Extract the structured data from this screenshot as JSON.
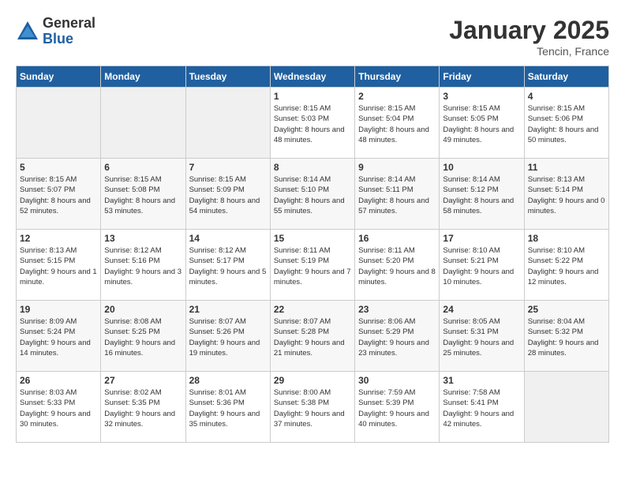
{
  "logo": {
    "general": "General",
    "blue": "Blue"
  },
  "title": "January 2025",
  "location": "Tencin, France",
  "days_of_week": [
    "Sunday",
    "Monday",
    "Tuesday",
    "Wednesday",
    "Thursday",
    "Friday",
    "Saturday"
  ],
  "weeks": [
    [
      {
        "day": "",
        "sunrise": "",
        "sunset": "",
        "daylight": ""
      },
      {
        "day": "",
        "sunrise": "",
        "sunset": "",
        "daylight": ""
      },
      {
        "day": "",
        "sunrise": "",
        "sunset": "",
        "daylight": ""
      },
      {
        "day": "1",
        "sunrise": "Sunrise: 8:15 AM",
        "sunset": "Sunset: 5:03 PM",
        "daylight": "Daylight: 8 hours and 48 minutes."
      },
      {
        "day": "2",
        "sunrise": "Sunrise: 8:15 AM",
        "sunset": "Sunset: 5:04 PM",
        "daylight": "Daylight: 8 hours and 48 minutes."
      },
      {
        "day": "3",
        "sunrise": "Sunrise: 8:15 AM",
        "sunset": "Sunset: 5:05 PM",
        "daylight": "Daylight: 8 hours and 49 minutes."
      },
      {
        "day": "4",
        "sunrise": "Sunrise: 8:15 AM",
        "sunset": "Sunset: 5:06 PM",
        "daylight": "Daylight: 8 hours and 50 minutes."
      }
    ],
    [
      {
        "day": "5",
        "sunrise": "Sunrise: 8:15 AM",
        "sunset": "Sunset: 5:07 PM",
        "daylight": "Daylight: 8 hours and 52 minutes."
      },
      {
        "day": "6",
        "sunrise": "Sunrise: 8:15 AM",
        "sunset": "Sunset: 5:08 PM",
        "daylight": "Daylight: 8 hours and 53 minutes."
      },
      {
        "day": "7",
        "sunrise": "Sunrise: 8:15 AM",
        "sunset": "Sunset: 5:09 PM",
        "daylight": "Daylight: 8 hours and 54 minutes."
      },
      {
        "day": "8",
        "sunrise": "Sunrise: 8:14 AM",
        "sunset": "Sunset: 5:10 PM",
        "daylight": "Daylight: 8 hours and 55 minutes."
      },
      {
        "day": "9",
        "sunrise": "Sunrise: 8:14 AM",
        "sunset": "Sunset: 5:11 PM",
        "daylight": "Daylight: 8 hours and 57 minutes."
      },
      {
        "day": "10",
        "sunrise": "Sunrise: 8:14 AM",
        "sunset": "Sunset: 5:12 PM",
        "daylight": "Daylight: 8 hours and 58 minutes."
      },
      {
        "day": "11",
        "sunrise": "Sunrise: 8:13 AM",
        "sunset": "Sunset: 5:14 PM",
        "daylight": "Daylight: 9 hours and 0 minutes."
      }
    ],
    [
      {
        "day": "12",
        "sunrise": "Sunrise: 8:13 AM",
        "sunset": "Sunset: 5:15 PM",
        "daylight": "Daylight: 9 hours and 1 minute."
      },
      {
        "day": "13",
        "sunrise": "Sunrise: 8:12 AM",
        "sunset": "Sunset: 5:16 PM",
        "daylight": "Daylight: 9 hours and 3 minutes."
      },
      {
        "day": "14",
        "sunrise": "Sunrise: 8:12 AM",
        "sunset": "Sunset: 5:17 PM",
        "daylight": "Daylight: 9 hours and 5 minutes."
      },
      {
        "day": "15",
        "sunrise": "Sunrise: 8:11 AM",
        "sunset": "Sunset: 5:19 PM",
        "daylight": "Daylight: 9 hours and 7 minutes."
      },
      {
        "day": "16",
        "sunrise": "Sunrise: 8:11 AM",
        "sunset": "Sunset: 5:20 PM",
        "daylight": "Daylight: 9 hours and 8 minutes."
      },
      {
        "day": "17",
        "sunrise": "Sunrise: 8:10 AM",
        "sunset": "Sunset: 5:21 PM",
        "daylight": "Daylight: 9 hours and 10 minutes."
      },
      {
        "day": "18",
        "sunrise": "Sunrise: 8:10 AM",
        "sunset": "Sunset: 5:22 PM",
        "daylight": "Daylight: 9 hours and 12 minutes."
      }
    ],
    [
      {
        "day": "19",
        "sunrise": "Sunrise: 8:09 AM",
        "sunset": "Sunset: 5:24 PM",
        "daylight": "Daylight: 9 hours and 14 minutes."
      },
      {
        "day": "20",
        "sunrise": "Sunrise: 8:08 AM",
        "sunset": "Sunset: 5:25 PM",
        "daylight": "Daylight: 9 hours and 16 minutes."
      },
      {
        "day": "21",
        "sunrise": "Sunrise: 8:07 AM",
        "sunset": "Sunset: 5:26 PM",
        "daylight": "Daylight: 9 hours and 19 minutes."
      },
      {
        "day": "22",
        "sunrise": "Sunrise: 8:07 AM",
        "sunset": "Sunset: 5:28 PM",
        "daylight": "Daylight: 9 hours and 21 minutes."
      },
      {
        "day": "23",
        "sunrise": "Sunrise: 8:06 AM",
        "sunset": "Sunset: 5:29 PM",
        "daylight": "Daylight: 9 hours and 23 minutes."
      },
      {
        "day": "24",
        "sunrise": "Sunrise: 8:05 AM",
        "sunset": "Sunset: 5:31 PM",
        "daylight": "Daylight: 9 hours and 25 minutes."
      },
      {
        "day": "25",
        "sunrise": "Sunrise: 8:04 AM",
        "sunset": "Sunset: 5:32 PM",
        "daylight": "Daylight: 9 hours and 28 minutes."
      }
    ],
    [
      {
        "day": "26",
        "sunrise": "Sunrise: 8:03 AM",
        "sunset": "Sunset: 5:33 PM",
        "daylight": "Daylight: 9 hours and 30 minutes."
      },
      {
        "day": "27",
        "sunrise": "Sunrise: 8:02 AM",
        "sunset": "Sunset: 5:35 PM",
        "daylight": "Daylight: 9 hours and 32 minutes."
      },
      {
        "day": "28",
        "sunrise": "Sunrise: 8:01 AM",
        "sunset": "Sunset: 5:36 PM",
        "daylight": "Daylight: 9 hours and 35 minutes."
      },
      {
        "day": "29",
        "sunrise": "Sunrise: 8:00 AM",
        "sunset": "Sunset: 5:38 PM",
        "daylight": "Daylight: 9 hours and 37 minutes."
      },
      {
        "day": "30",
        "sunrise": "Sunrise: 7:59 AM",
        "sunset": "Sunset: 5:39 PM",
        "daylight": "Daylight: 9 hours and 40 minutes."
      },
      {
        "day": "31",
        "sunrise": "Sunrise: 7:58 AM",
        "sunset": "Sunset: 5:41 PM",
        "daylight": "Daylight: 9 hours and 42 minutes."
      },
      {
        "day": "",
        "sunrise": "",
        "sunset": "",
        "daylight": ""
      }
    ]
  ]
}
